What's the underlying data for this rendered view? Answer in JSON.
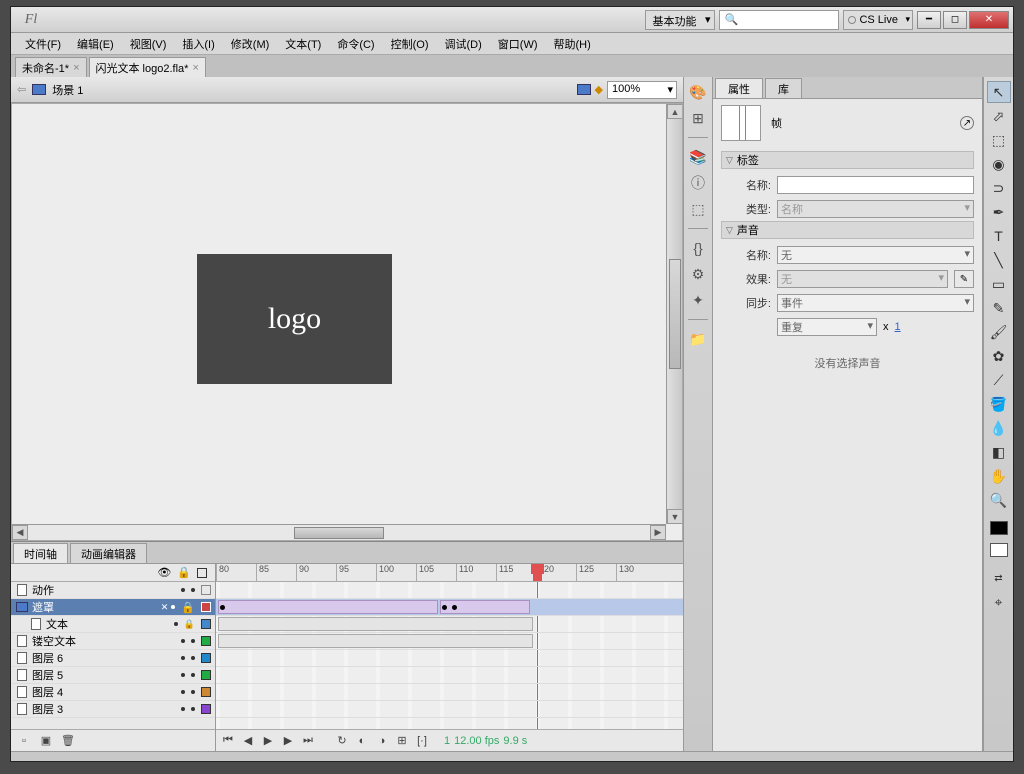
{
  "titlebar": {
    "workspace": "基本功能",
    "search_placeholder": "",
    "cslive": "CS Live"
  },
  "menu": [
    "文件(F)",
    "编辑(E)",
    "视图(V)",
    "插入(I)",
    "修改(M)",
    "文本(T)",
    "命令(C)",
    "控制(O)",
    "调试(D)",
    "窗口(W)",
    "帮助(H)"
  ],
  "doc_tabs": [
    {
      "label": "未命名-1*"
    },
    {
      "label": "闪光文本 logo2.fla*"
    }
  ],
  "scene": {
    "name": "场景 1",
    "zoom": "100%"
  },
  "stage": {
    "logo_text": "logo"
  },
  "bottom_tabs": [
    "时间轴",
    "动画编辑器"
  ],
  "ruler_marks": [
    80,
    85,
    90,
    95,
    100,
    105,
    110,
    115,
    120,
    125,
    130
  ],
  "layers": [
    {
      "name": "动作",
      "type": "normal"
    },
    {
      "name": "遮罩",
      "type": "mask",
      "selected": true
    },
    {
      "name": "文本",
      "type": "masked"
    },
    {
      "name": "镂空文本",
      "type": "normal"
    },
    {
      "name": "图层 6",
      "type": "normal",
      "color": "#28c"
    },
    {
      "name": "图层 5",
      "type": "normal",
      "color": "#2a4"
    },
    {
      "name": "图层 4",
      "type": "normal",
      "color": "#c83"
    },
    {
      "name": "图层 3",
      "type": "normal",
      "color": "#84c"
    }
  ],
  "timeline_status": {
    "frame": "1",
    "fps": "12.00 fps",
    "time": "9.9 s"
  },
  "panel_tabs": [
    "属性",
    "库"
  ],
  "properties": {
    "title": "帧",
    "sections": {
      "label": "标签",
      "sound": "声音"
    },
    "label_name": "名称:",
    "label_type_label": "类型:",
    "label_type_value": "名称",
    "sound_name_label": "名称:",
    "sound_name_value": "无",
    "sound_effect_label": "效果:",
    "sound_effect_value": "无",
    "sound_sync_label": "同步:",
    "sound_sync_value": "事件",
    "sound_repeat": "重复",
    "sound_x": "x",
    "sound_count": "1",
    "no_sound": "没有选择声音"
  }
}
